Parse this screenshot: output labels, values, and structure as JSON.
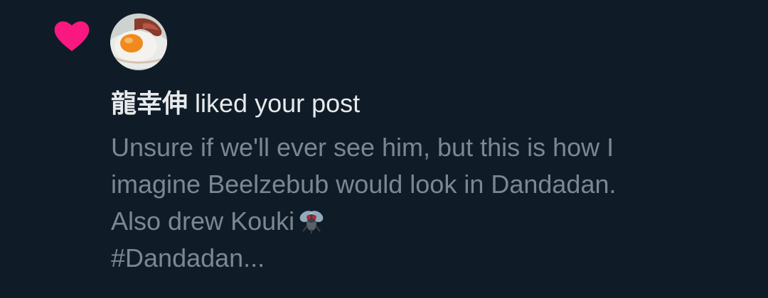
{
  "notification": {
    "type_icon": "heart-icon",
    "accent_color": "#f91880",
    "avatar_icon": "fried-egg-avatar",
    "liker_name": "龍幸伸",
    "action_text": "liked your post",
    "post_preview": {
      "line1": "Unsure if we'll ever see him, but this is how I",
      "line2": "imagine Beelzebub would look in Dandadan.",
      "line3": "Also drew Kouki",
      "line3_emoji": "fly-icon",
      "line4": "#Dandadan..."
    }
  }
}
